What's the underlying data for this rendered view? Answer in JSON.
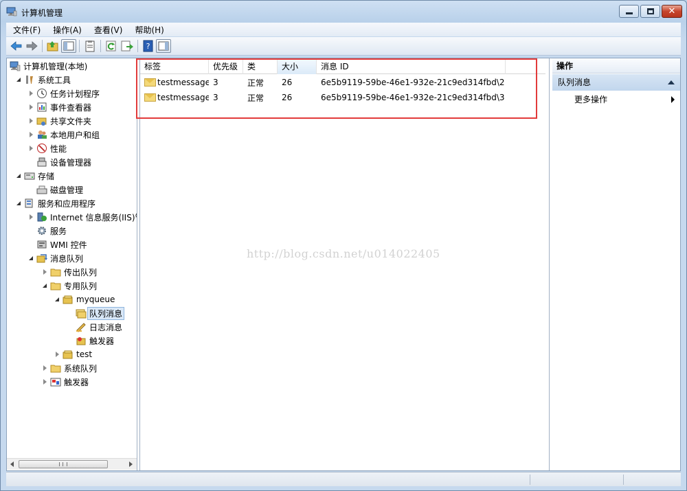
{
  "window": {
    "title": "计算机管理"
  },
  "menu": [
    {
      "label": "文件(F)"
    },
    {
      "label": "操作(A)"
    },
    {
      "label": "查看(V)"
    },
    {
      "label": "帮助(H)"
    }
  ],
  "tree": {
    "items": [
      {
        "label": "计算机管理(本地)",
        "icon": "computer-management-icon",
        "level": 0,
        "toggle": "none"
      },
      {
        "label": "系统工具",
        "icon": "tools-icon",
        "level": 1,
        "toggle": "open"
      },
      {
        "label": "任务计划程序",
        "icon": "clock-icon",
        "level": 2,
        "toggle": "closed"
      },
      {
        "label": "事件查看器",
        "icon": "event-viewer-icon",
        "level": 2,
        "toggle": "closed"
      },
      {
        "label": "共享文件夹",
        "icon": "shared-folder-icon",
        "level": 2,
        "toggle": "closed"
      },
      {
        "label": "本地用户和组",
        "icon": "users-icon",
        "level": 2,
        "toggle": "closed"
      },
      {
        "label": "性能",
        "icon": "performance-icon",
        "level": 2,
        "toggle": "closed"
      },
      {
        "label": "设备管理器",
        "icon": "device-manager-icon",
        "level": 2,
        "toggle": "none"
      },
      {
        "label": "存储",
        "icon": "storage-icon",
        "level": 1,
        "toggle": "open"
      },
      {
        "label": "磁盘管理",
        "icon": "disk-icon",
        "level": 2,
        "toggle": "none"
      },
      {
        "label": "服务和应用程序",
        "icon": "services-apps-icon",
        "level": 1,
        "toggle": "open"
      },
      {
        "label": "Internet 信息服务(IIS)管",
        "icon": "iis-icon",
        "level": 2,
        "toggle": "closed"
      },
      {
        "label": "服务",
        "icon": "gear-icon",
        "level": 2,
        "toggle": "none"
      },
      {
        "label": "WMI 控件",
        "icon": "wmi-icon",
        "level": 2,
        "toggle": "none"
      },
      {
        "label": "消息队列",
        "icon": "message-queue-icon",
        "level": 2,
        "toggle": "open"
      },
      {
        "label": "传出队列",
        "icon": "folder-icon",
        "level": 3,
        "toggle": "closed"
      },
      {
        "label": "专用队列",
        "icon": "folder-icon",
        "level": 3,
        "toggle": "open"
      },
      {
        "label": "myqueue",
        "icon": "queue-icon",
        "level": 4,
        "toggle": "open"
      },
      {
        "label": "队列消息",
        "icon": "queue-messages-icon",
        "level": 5,
        "toggle": "none",
        "selected": true
      },
      {
        "label": "日志消息",
        "icon": "journal-icon",
        "level": 5,
        "toggle": "none"
      },
      {
        "label": "触发器",
        "icon": "trigger-icon",
        "level": 5,
        "toggle": "none"
      },
      {
        "label": "test",
        "icon": "queue-icon",
        "level": 4,
        "toggle": "closed"
      },
      {
        "label": "系统队列",
        "icon": "folder-icon",
        "level": 3,
        "toggle": "closed"
      },
      {
        "label": "触发器",
        "icon": "triggers-icon",
        "level": 3,
        "toggle": "closed"
      }
    ]
  },
  "list": {
    "columns": [
      {
        "label": "标签"
      },
      {
        "label": "优先级"
      },
      {
        "label": "类"
      },
      {
        "label": "大小"
      },
      {
        "label": "消息 ID"
      }
    ],
    "rows": [
      {
        "label": "testmessage",
        "priority": "3",
        "class": "正常",
        "size": "26",
        "id": "6e5b9119-59be-46e1-932e-21c9ed314fbd\\2"
      },
      {
        "label": "testmessage",
        "priority": "3",
        "class": "正常",
        "size": "26",
        "id": "6e5b9119-59be-46e1-932e-21c9ed314fbd\\3"
      }
    ]
  },
  "watermark": "http://blog.csdn.net/u014022405",
  "actions": {
    "header": "操作",
    "section": "队列消息",
    "more": "更多操作"
  },
  "colors": {
    "highlight": "#e23a3a",
    "title_bg": "#c6d9ee",
    "selection": "#d9e8f8"
  }
}
